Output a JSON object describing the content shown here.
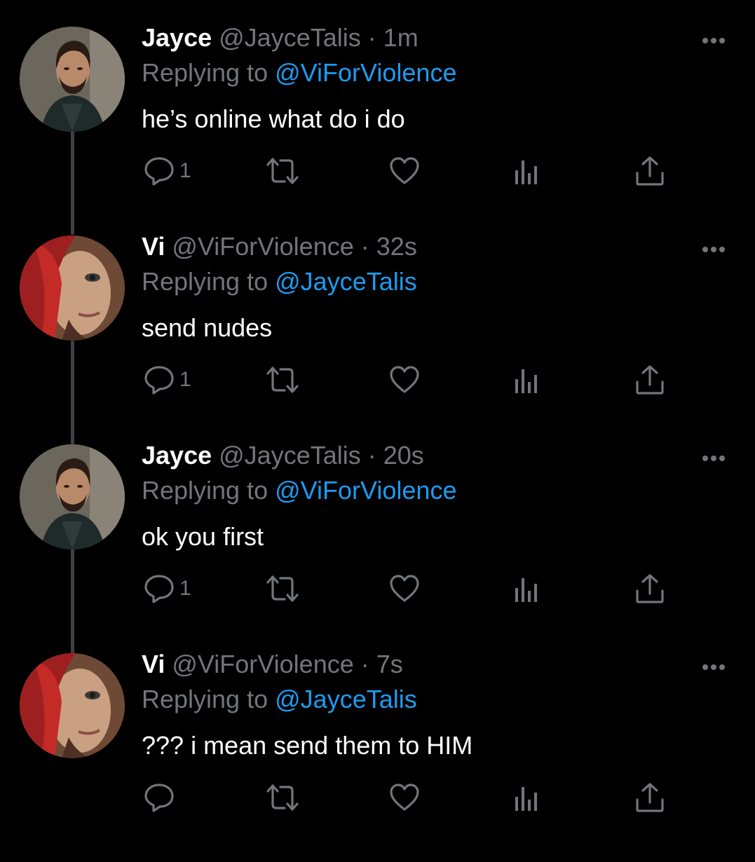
{
  "colors": {
    "background": "#000000",
    "name": "#ffffff",
    "muted": "#71767b",
    "link": "#1d9bf0",
    "thread_line": "#3e4144"
  },
  "tweets": [
    {
      "name": "Jayce",
      "handle": "@JayceTalis",
      "separator": "·",
      "time": "1m",
      "replying_label": "Replying to",
      "replying_to": "@ViForViolence",
      "text": "he’s online what do i do",
      "reply_count": "1",
      "avatar": "jayce-avatar"
    },
    {
      "name": "Vi",
      "handle": "@ViForViolence",
      "separator": "·",
      "time": "32s",
      "replying_label": "Replying to",
      "replying_to": "@JayceTalis",
      "text": "send nudes",
      "reply_count": "1",
      "avatar": "vi-avatar"
    },
    {
      "name": "Jayce",
      "handle": "@JayceTalis",
      "separator": "·",
      "time": "20s",
      "replying_label": "Replying to",
      "replying_to": "@ViForViolence",
      "text": "ok you first",
      "reply_count": "1",
      "avatar": "jayce-avatar"
    },
    {
      "name": "Vi",
      "handle": "@ViForViolence",
      "separator": "·",
      "time": "7s",
      "replying_label": "Replying to",
      "replying_to": "@JayceTalis",
      "text": "??? i mean send them to HIM",
      "reply_count": "",
      "avatar": "vi-avatar"
    }
  ],
  "icons": {
    "reply": "reply-icon",
    "retweet": "retweet-icon",
    "like": "heart-icon",
    "analytics": "analytics-icon",
    "share": "share-icon",
    "more": "more-icon"
  }
}
